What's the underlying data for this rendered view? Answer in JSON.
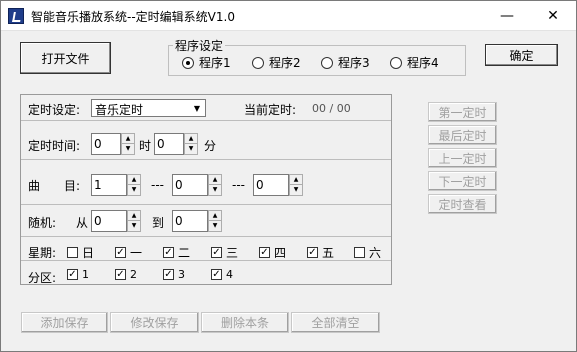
{
  "window": {
    "title": "智能音乐播放系统--定时编辑系统V1.0",
    "minimize_glyph": "—",
    "close_glyph": "✕"
  },
  "toolbar": {
    "open_file": "打开文件",
    "confirm": "确定"
  },
  "program_settings": {
    "legend": "程序设定",
    "options": [
      "程序1",
      "程序2",
      "程序3",
      "程序4"
    ],
    "selected_index": 0
  },
  "timer": {
    "setting_label": "定时设定:",
    "setting_value": "音乐定时",
    "current_label": "当前定时:",
    "current_value": "00 / 00",
    "time_label": "定时时间:",
    "hour_value": "0",
    "hour_unit": "时",
    "minute_value": "0",
    "minute_unit": "分",
    "song_label": "曲　　目:",
    "song_values": [
      "1",
      "0",
      "0"
    ],
    "song_separator": "---",
    "random_label": "随机:",
    "random_from_label": "从",
    "random_from": "0",
    "random_to_label": "到",
    "random_to": "0",
    "week_label": "星期:",
    "week_days": [
      {
        "label": "日",
        "checked": false
      },
      {
        "label": "一",
        "checked": true
      },
      {
        "label": "二",
        "checked": true
      },
      {
        "label": "三",
        "checked": true
      },
      {
        "label": "四",
        "checked": true
      },
      {
        "label": "五",
        "checked": true
      },
      {
        "label": "六",
        "checked": false
      }
    ],
    "zone_label": "分区:",
    "zones": [
      {
        "label": "1",
        "checked": true
      },
      {
        "label": "2",
        "checked": true
      },
      {
        "label": "3",
        "checked": true
      },
      {
        "label": "4",
        "checked": true
      }
    ]
  },
  "navigation": {
    "first": "第一定时",
    "last": "最后定时",
    "prev": "上一定时",
    "next": "下一定时",
    "view": "定时查看"
  },
  "actions": {
    "add_save": "添加保存",
    "modify_save": "修改保存",
    "delete_entry": "删除本条",
    "clear_all": "全部清空"
  }
}
